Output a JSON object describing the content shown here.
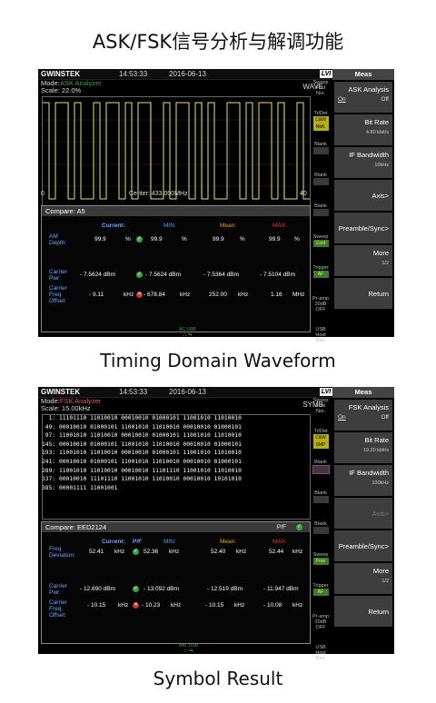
{
  "captions": {
    "title": "ASK/FSK信号分析与解调功能",
    "ask": "Timing Domain Waveform",
    "fsk": "Symbol Result"
  },
  "panel1": {
    "logo": "GWINSTEK",
    "time": "14:53:33",
    "date": "2016-06-13",
    "lvi": "LVI",
    "mode_label": "Mode:",
    "mode_value": "ASK Analyzer",
    "scale": "Scale: 22.0%",
    "view": "WAVE",
    "side": {
      "sweep": "Sweep",
      "fast": "Fast",
      "nor": "Nor.",
      "trdet": "Tr/Det",
      "caw": "C&W",
      "nml": "NML",
      "blank": "Blank",
      "trigger": "Trigger",
      "af": "AF",
      "preamp": "Pr-amp",
      "db": "20dB",
      "off": "OFF",
      "usb": "USB",
      "host": "Host",
      "dev": "Dev.",
      "cont": "Cont"
    },
    "axis": {
      "left": "0",
      "center": "Center: 433.000MHz",
      "right": "40"
    },
    "menu": {
      "title": "Meas",
      "b1": "ASK Analysis",
      "b1_on": "On",
      "b1_off": "Off",
      "b2": "Bit Rate",
      "b2_sub": "4.80 kbit/s",
      "b3": "IF Bandwidth",
      "b3_sub": "10kHz",
      "b4": "Axis>",
      "b5": "Preamble/Sync>",
      "b6": "More",
      "b6_sub": "1/2",
      "b7": "Return"
    },
    "result": {
      "title": "Compare: A5",
      "headers": {
        "current": "Current:",
        "min": "MIN:",
        "mean": "Mean:",
        "max": "MAX:"
      },
      "rows": [
        {
          "label1": "AM",
          "label2": "Depth:",
          "cur": "99.9",
          "cur_u": "%",
          "min": "99.9",
          "min_u": "%",
          "mean": "99.9",
          "mean_u": "%",
          "max": "99.9",
          "max_u": "%"
        },
        {
          "label1": "Carrier",
          "label2": "Pwr:",
          "cur": "- 7.5624 dBm",
          "min": "- 7.5624 dBm",
          "mean": "- 7.5364 dBm",
          "max": "- 7.5104 dBm"
        },
        {
          "label1": "Carrier",
          "label2": "Freq",
          "label3": "Offset:",
          "cur": "- 9.11",
          "cur_u": "kHz",
          "min": "- 678.84",
          "min_u": "kHz",
          "mean": "252.00",
          "mean_u": "kHz",
          "max": "1.16",
          "max_u": "MHz"
        }
      ]
    },
    "bottom": "AC USB"
  },
  "panel2": {
    "logo": "GWINSTEK",
    "time": "14:53:33",
    "date": "2016-06-13",
    "lvi": "LVI",
    "mode_label": "Mode:",
    "mode_value": "FSK Analyzer",
    "scale": "Scale: 15.00kHz",
    "view": "SYMB",
    "side": {
      "sweep": "Sweep",
      "fast": "Fast",
      "nor": "Nor.",
      "trdet": "Tr/Det",
      "caw": "C&W",
      "smp": "SMP",
      "blank": "Blank",
      "trigger": "Trigger",
      "af": "AF",
      "preamp": "Pr-amp",
      "db": "20dB",
      "off": "OFF",
      "usb": "USB",
      "host": "Host",
      "dev": "Dev.",
      "free": "Free"
    },
    "symbols": [
      "  1: 11101110 11010010 00010010 01000101 11001010 11010010",
      " 49: 00010010 01000101 11001010 11010010 00010010 01000101",
      " 97: 11001010 11010010 00010010 01000101 11001010 11010010",
      "145: 00010010 01000101 11001010 11010010 00010010 01000101",
      "193: 11001010 11010010 00010010 01000101 11001010 11010010",
      "241: 00010010 01000101 11001010 11010010 00010010 01000101",
      "289: 11001010 11010010 00010010 11101110 11001010 11010010",
      "337: 00010010 11101110 11001010 11010010 00010010 10101010",
      "385: 00001111 11001001"
    ],
    "menu": {
      "title": "Meas",
      "b1": "FSK Analysis",
      "b1_on": "On",
      "b1_off": "Off",
      "b2": "Bit Rate",
      "b2_sub": "19.20 kbit/s",
      "b3": "IF Bandwidth",
      "b3_sub": "100kHz",
      "b4": "Axis>",
      "b5": "Preamble/Sync>",
      "b6": "More",
      "b6_sub": "1/2",
      "b7": "Return"
    },
    "result": {
      "title": "Compare: EED2124",
      "pf": "P/F",
      "headers": {
        "current": "Current:",
        "pf": "P/F",
        "min": "MIN:",
        "mean": "Mean:",
        "max": "MAX:"
      },
      "rows": [
        {
          "label1": "Freq",
          "label2": "Deviation:",
          "cur": "52.41",
          "cur_u": "kHz",
          "min": "52.36",
          "min_u": "kHz",
          "mean": "52.40",
          "mean_u": "kHz",
          "max": "52.44",
          "max_u": "kHz"
        },
        {
          "label1": "Carrier",
          "label2": "Pwr:",
          "cur": "- 12.690 dBm",
          "min": "- 13.092 dBm",
          "mean": "- 12.519 dBm",
          "max": "- 11.947 dBm"
        },
        {
          "label1": "Carrier",
          "label2": "Freq",
          "label3": "Offset:",
          "cur": "- 10.15",
          "cur_u": "kHz",
          "min": "- 10.23",
          "min_u": "kHz",
          "mean": "- 10.15",
          "mean_u": "kHz",
          "max": "- 10.08",
          "max_u": "kHz"
        }
      ]
    },
    "bottom": "BAT USB"
  }
}
